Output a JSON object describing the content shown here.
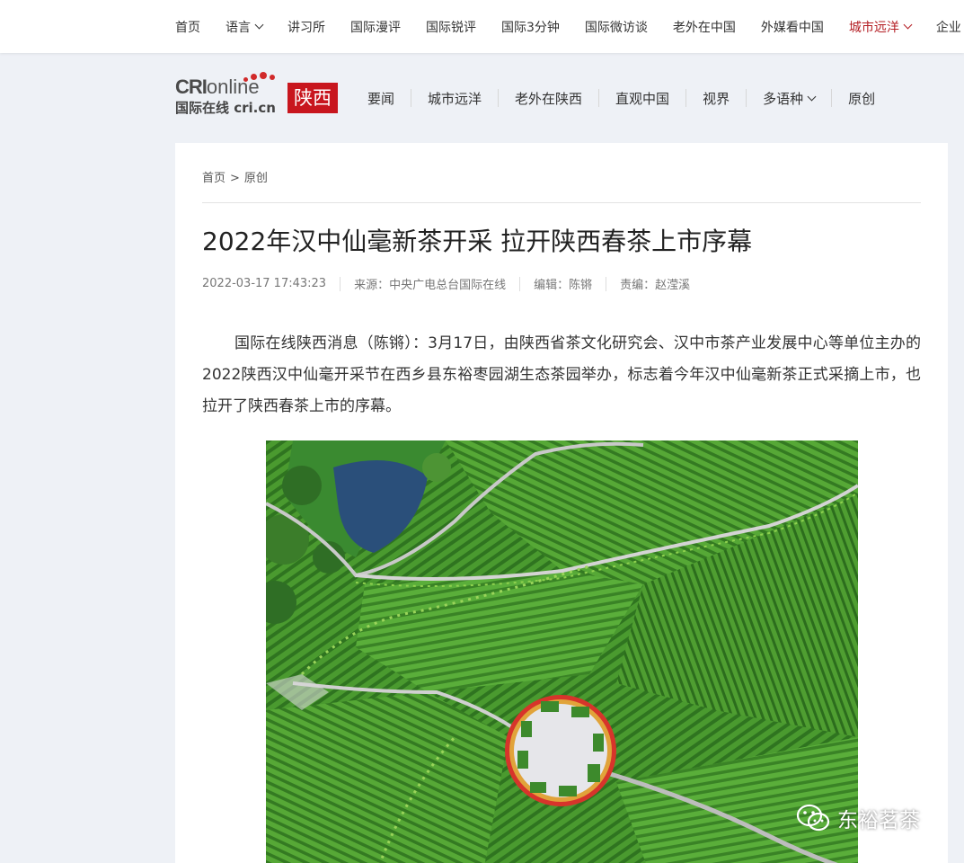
{
  "top_nav": {
    "items": [
      {
        "label": "首页"
      },
      {
        "label": "语言",
        "has_dropdown": true
      },
      {
        "label": "讲习所"
      },
      {
        "label": "国际漫评"
      },
      {
        "label": "国际锐评"
      },
      {
        "label": "国际3分钟"
      },
      {
        "label": "国际微访谈"
      },
      {
        "label": "老外在中国"
      },
      {
        "label": "外媒看中国"
      },
      {
        "label": "城市远洋",
        "has_dropdown": true,
        "active": true
      },
      {
        "label": "企业"
      }
    ],
    "active_color": "#b41d23"
  },
  "logo": {
    "brand": "CRI",
    "online": "online",
    "subtitle": "国际在线 cri.cn",
    "channel": "陕西",
    "channel_color": "#c8161e"
  },
  "channel_nav": {
    "items": [
      {
        "label": "要闻"
      },
      {
        "label": "城市远洋"
      },
      {
        "label": "老外在陕西"
      },
      {
        "label": "直观中国"
      },
      {
        "label": "视界"
      },
      {
        "label": "多语种",
        "has_dropdown": true
      },
      {
        "label": "原创"
      }
    ]
  },
  "breadcrumb": {
    "home": "首页",
    "separator": ">",
    "current": "原创"
  },
  "article": {
    "title": "2022年汉中仙毫新茶开采 拉开陕西春茶上市序幕",
    "datetime": "2022-03-17 17:43:23",
    "source": "来源：中央广电总台国际在线",
    "editor": "编辑：陈锵",
    "chief_editor": "责编：赵滢溪",
    "paragraph": "国际在线陕西消息（陈锵）：3月17日，由陕西省茶文化研究会、汉中市茶产业发展中心等单位主办的2022陕西汉中仙毫开采节在西乡县东裕枣园湖生态茶园举办，标志着今年汉中仙毫新茶正式采摘上市，也拉开了陕西春茶上市的序幕。"
  },
  "watermark": {
    "icon": "wechat-icon",
    "text": "东裕茗茶"
  }
}
